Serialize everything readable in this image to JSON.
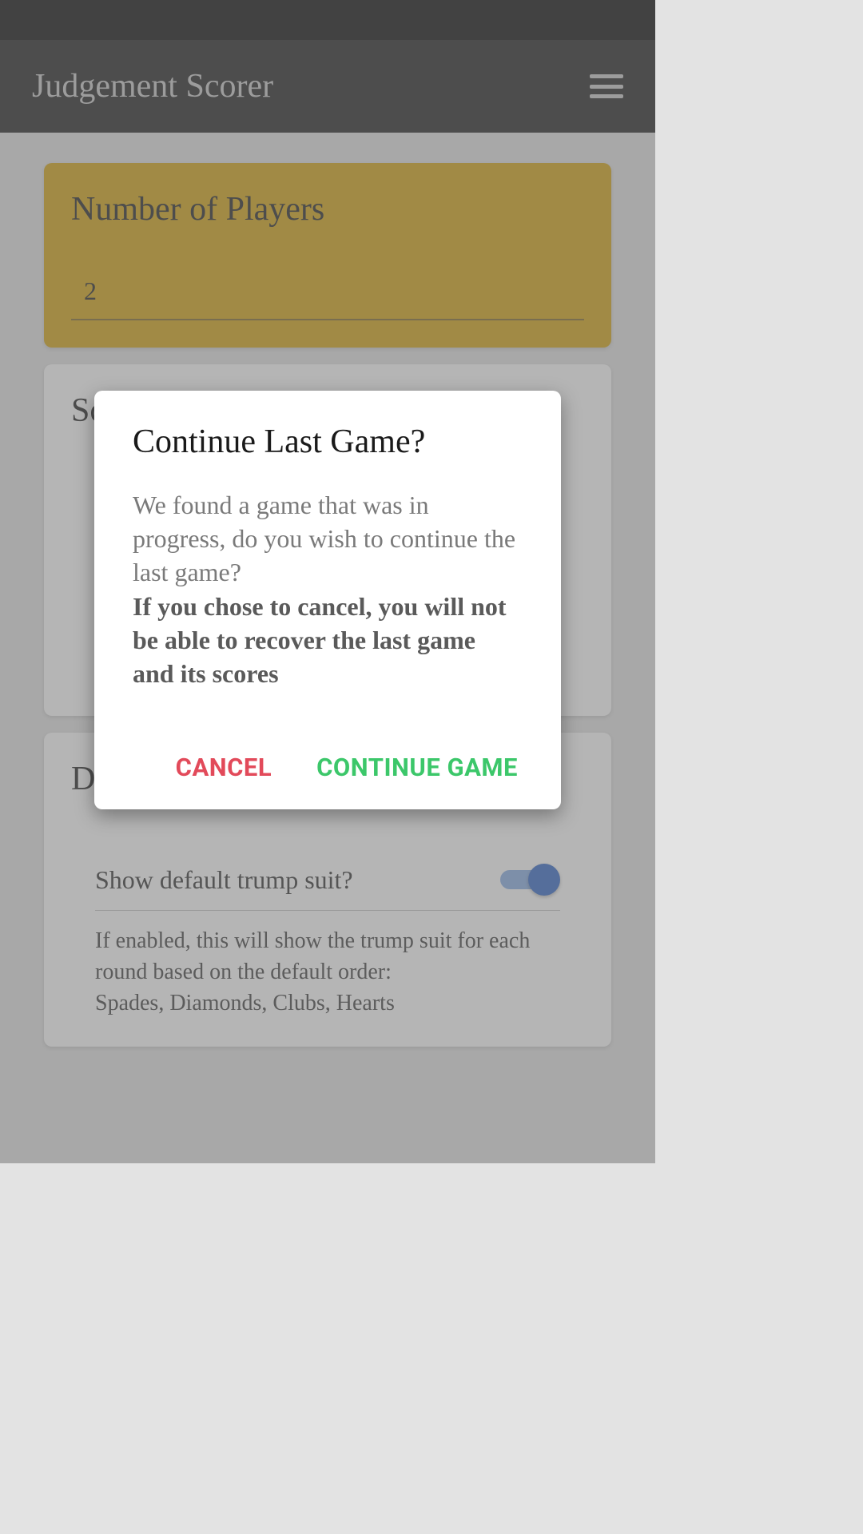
{
  "header": {
    "title": "Judgement Scorer"
  },
  "cards": {
    "players": {
      "title": "Number of Players",
      "value": "2"
    },
    "scoring": {
      "title_prefix": "Sc"
    },
    "trump": {
      "title": "Default trump suit",
      "switch_label": "Show default trump suit?",
      "switch_on": true,
      "help_line1": "If enabled, this will show the trump suit for each round based on the default order:",
      "help_line2": "Spades, Diamonds, Clubs, Hearts"
    }
  },
  "dialog": {
    "title": "Continue Last Game?",
    "body": "We found a game that was in progress, do you wish to continue the last game?",
    "body_strong": "If you chose to cancel, you will not be able to recover the last game and its scores",
    "cancel_label": "CANCEL",
    "continue_label": "CONTINUE GAME"
  }
}
